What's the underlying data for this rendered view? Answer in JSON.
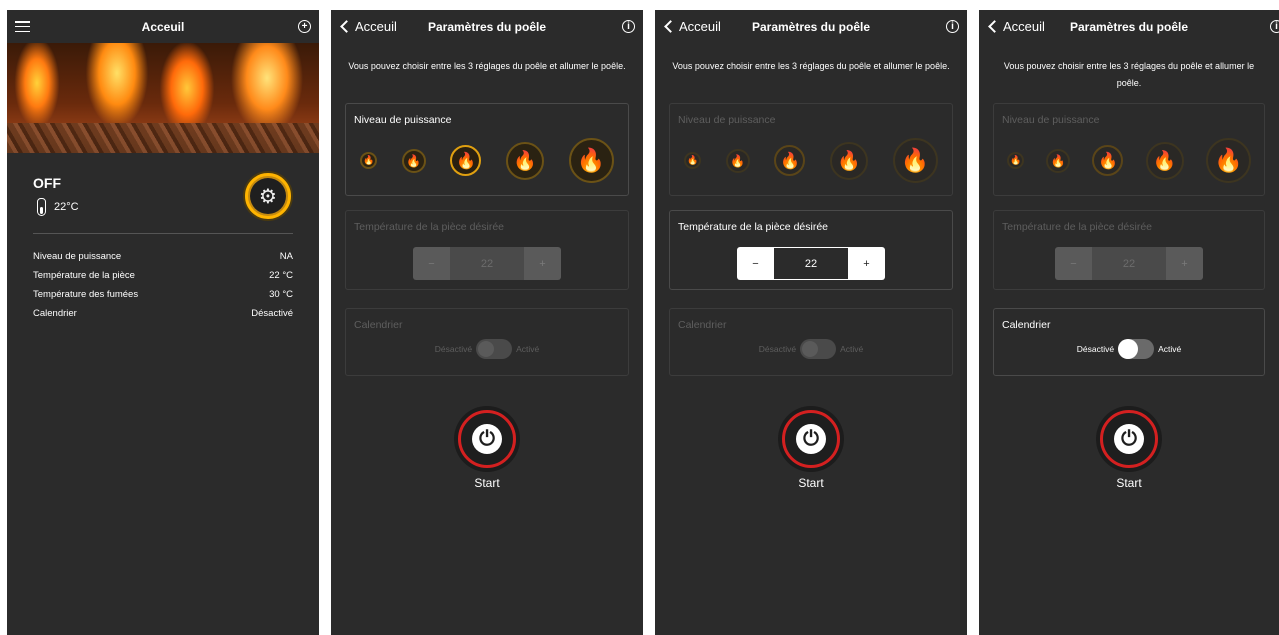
{
  "home": {
    "title": "Acceuil",
    "status": "OFF",
    "temperature": "22°C",
    "rows": [
      {
        "label": "Niveau de puissance",
        "value": "NA"
      },
      {
        "label": "Température de la pièce",
        "value": "22 °C"
      },
      {
        "label": "Température des fumées",
        "value": "30 °C"
      },
      {
        "label": "Calendrier",
        "value": "Désactivé"
      }
    ]
  },
  "settings": {
    "back_label": "Acceuil",
    "title": "Paramètres du poêle",
    "description": "Vous pouvez choisir entre les 3 réglages du poêle et allumer le poêle.",
    "power_label": "Niveau de puissance",
    "temp_label": "Température de la pièce désirée",
    "temp_minus": "−",
    "temp_value": "22",
    "temp_plus": "+",
    "calendar_label": "Calendrier",
    "toggle_off": "Désactivé",
    "toggle_on": "Activé",
    "start_label": "Start"
  },
  "icons": {
    "menu": "hamburger-icon",
    "add": "plus-circle-icon",
    "info": "info-icon",
    "back": "chevron-left-icon",
    "settings": "gear-icon",
    "thermometer": "thermometer-icon",
    "flame": "flame-icon",
    "power": "power-icon"
  },
  "colors": {
    "background": "#2b2b2b",
    "accent": "#ffb400",
    "power_ring": "#d42020"
  }
}
